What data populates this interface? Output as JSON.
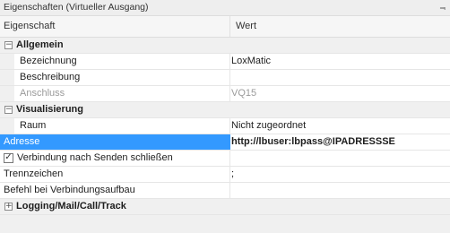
{
  "panel": {
    "title": "Eigenschaften (Virtueller Ausgang)",
    "pin_glyph": "⫬"
  },
  "header": {
    "col_property": "Eigenschaft",
    "col_value": "Wert"
  },
  "groups": {
    "allgemein": {
      "title": "Allgemein",
      "toggle": "−",
      "rows": [
        {
          "label": "Bezeichnung",
          "value": "LoxMatic"
        },
        {
          "label": "Beschreibung",
          "value": ""
        },
        {
          "label": "Anschluss",
          "value": "VQ15"
        }
      ]
    },
    "visualisierung": {
      "title": "Visualisierung",
      "toggle": "−",
      "rows": [
        {
          "label": "Raum",
          "value": "Nicht zugeordnet"
        }
      ]
    },
    "logging": {
      "title": "Logging/Mail/Call/Track",
      "toggle": "+"
    }
  },
  "adresse": {
    "label": "Adresse",
    "value": "http://lbuser:lbpass@IPADRESSSE"
  },
  "verbindung": {
    "label": "Verbindung nach Senden schließen",
    "checked_glyph": "✓"
  },
  "trennzeichen": {
    "label": "Trennzeichen",
    "value": ";"
  },
  "befehl": {
    "label": "Befehl bei Verbindungsaufbau",
    "value": ""
  }
}
